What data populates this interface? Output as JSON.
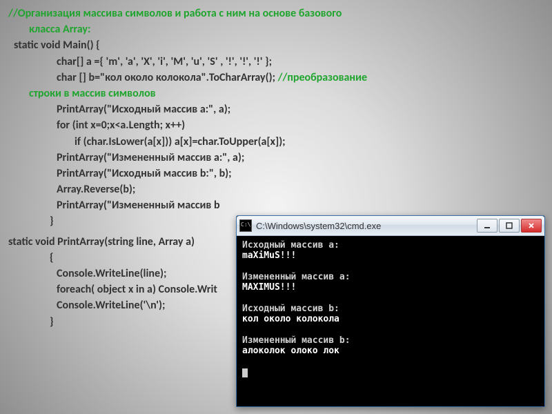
{
  "comment1_a": "//Организация массива символов и работа с ним на  основе базового",
  "comment1_b": "класса Array:",
  "l1": " static void Main()         {",
  "l2": "char[] a ={ 'm', 'a', 'X',  'i', 'M', 'u', 'S' , '!', '!', '!' };",
  "l3_a": "char [] b=\"кол около колокола\".ToCharArray(); ",
  "l3_comment_a": "//преобразование",
  "l3_comment_b": "строки в массив символов",
  "l4": "PrintArray(\"Исходный массив а:\", a);",
  "l5": "for (int x=0;x<a.Length; x++)",
  "l6": "if (char.IsLower(a[x])) a[x]=char.ToUpper(a[x]);",
  "l7": "PrintArray(\"Измененный массив а:\", a);",
  "l8": "PrintArray(\"Исходный массив b:\", b);",
  "l9": "Array.Reverse(b);",
  "l10": "PrintArray(\"Измененный массив b",
  "l11": "}",
  "l12": "static void PrintArray(string line, Array a)",
  "l13": "{",
  "l14": "Console.WriteLine(line);",
  "l15": "foreach( object x in a) Console.Writ",
  "l16": "Console.WriteLine('\\n');",
  "l17": "}",
  "console": {
    "title": "C:\\Windows\\system32\\cmd.exe",
    "lines": [
      {
        "h": "Исходный массив а:",
        "v": "maXiMuS!!!"
      },
      {
        "h": "Измененный массив а:",
        "v": "MAXIMUS!!!"
      },
      {
        "h": "Исходный массив b:",
        "v": "кол около колокола"
      },
      {
        "h": "Измененный массив b:",
        "v": "алоколок олоко лок"
      }
    ]
  }
}
